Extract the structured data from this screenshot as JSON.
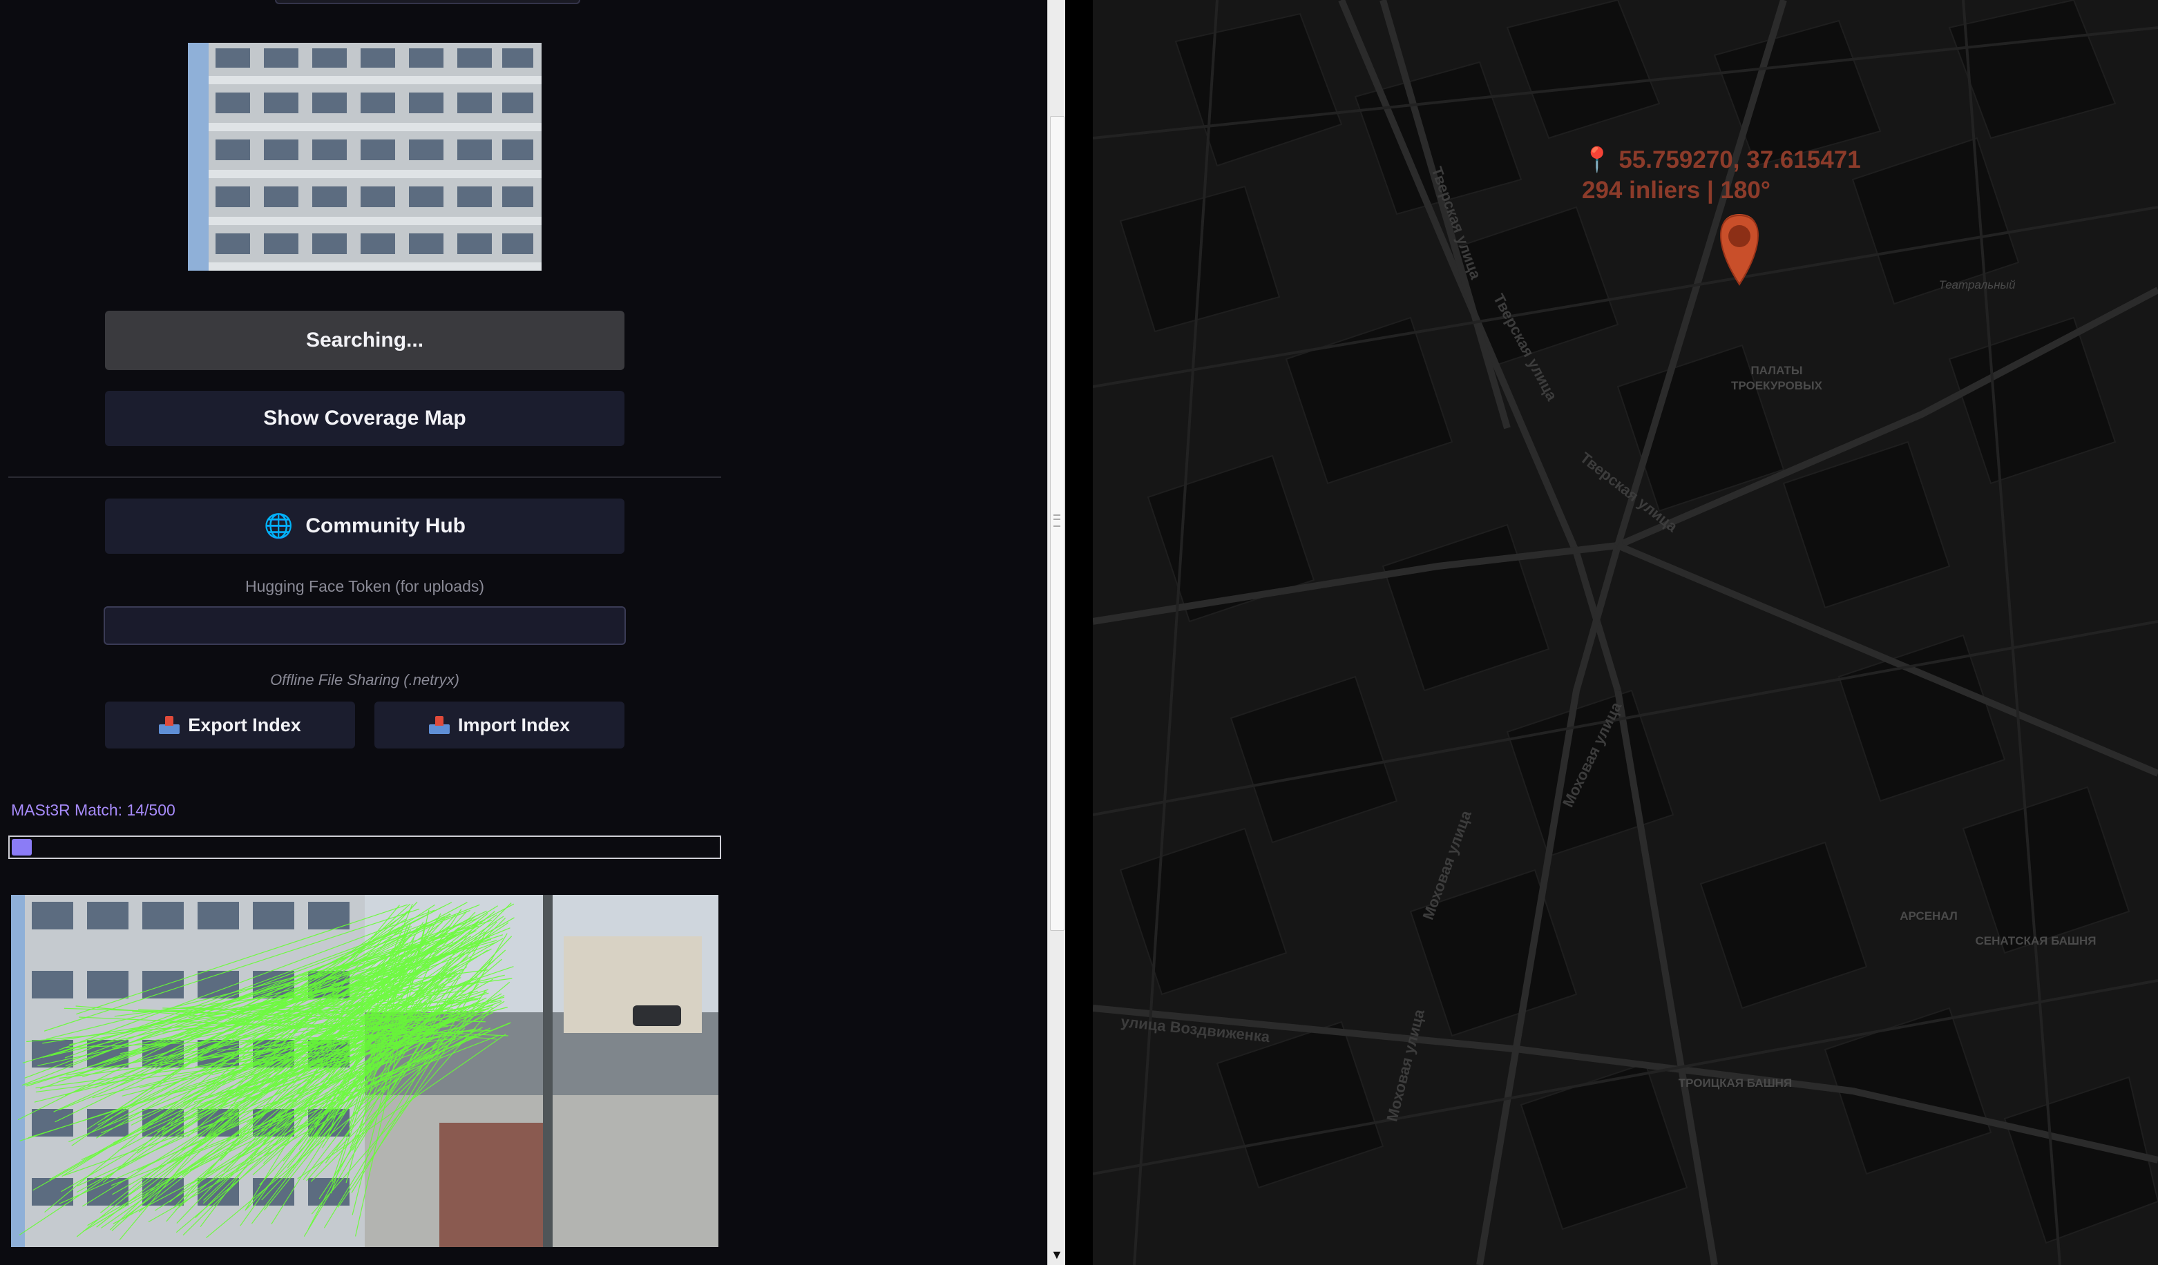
{
  "left_panel": {
    "search_button_label": "Searching...",
    "coverage_button_label": "Show Coverage Map",
    "community_hub_label": "Community Hub",
    "token_label": "Hugging Face Token (for uploads)",
    "token_value": "",
    "offline_label": "Offline File Sharing (.netryx)",
    "export_label": "Export Index",
    "import_label": "Import Index",
    "match_label": "MASt3R Match: 14/500",
    "match_progress": 0.028
  },
  "map": {
    "pin_coords": "55.759270, 37.615471",
    "pin_info": "294 inliers | 180°",
    "labels": {
      "palaty": "ПАЛАТЫ ТРОЕКУРОВЫХ",
      "arsenal": "АРСЕНАЛ",
      "senatskaya": "СЕНАТСКАЯ БАШНЯ",
      "troitskaya": "ТРОИЦКАЯ БАШНЯ",
      "teatralny": "Театральный",
      "tverskaya1": "Тверская улица",
      "tverskaya2": "Тверская улица",
      "tverskaya3": "Тверская улица",
      "mokhovaya1": "Моховая улица",
      "mokhovaya2": "Моховая улица",
      "mokhovaya3": "Моховая улица",
      "vozdvizhenka": "улица Воздвиженка"
    }
  },
  "colors": {
    "background": "#0b0b10",
    "button": "#1b1d2e",
    "searching_button": "#3a3a3e",
    "accent_purple": "#a78bfa",
    "pin": "#d9562f",
    "match_lines": "#66ff33"
  }
}
